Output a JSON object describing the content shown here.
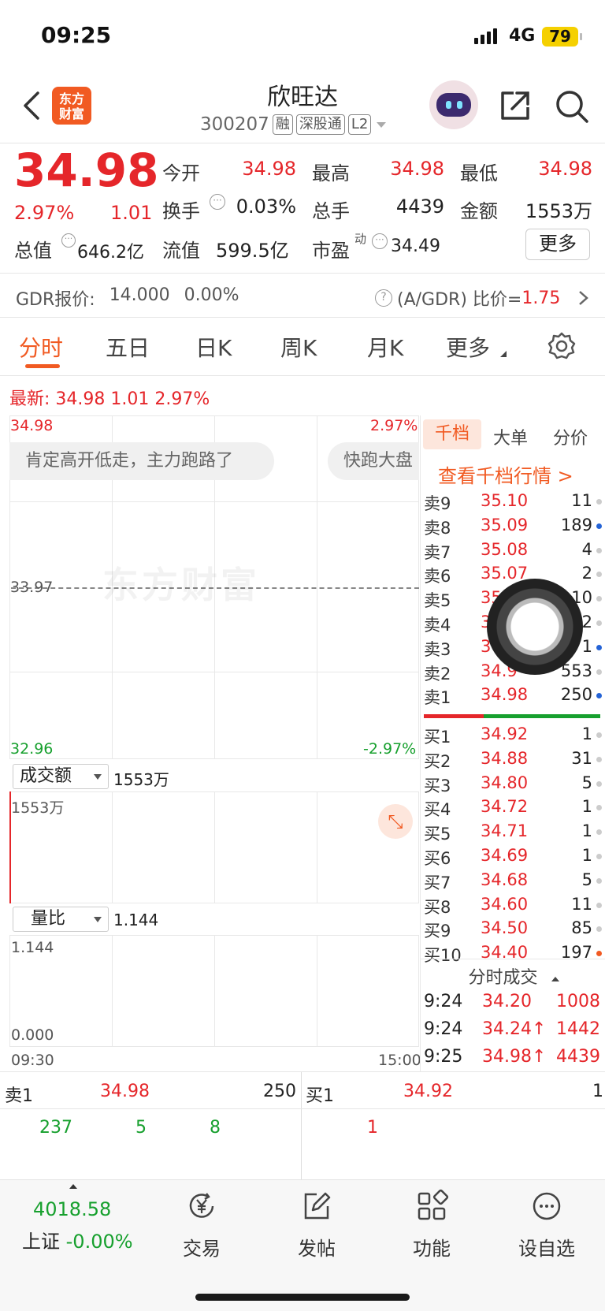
{
  "status": {
    "time": "09:25",
    "network": "4G",
    "battery": "79"
  },
  "header": {
    "logo": "东方财富",
    "stock_name": "欣旺达",
    "stock_code": "300207",
    "tags": [
      "融",
      "深股通",
      "L2"
    ]
  },
  "quote": {
    "price": "34.98",
    "change_pct": "2.97%",
    "change": "1.01",
    "fields": {
      "open_label": "今开",
      "open": "34.98",
      "high_label": "最高",
      "high": "34.98",
      "low_label": "最低",
      "low": "34.98",
      "turnover_label": "换手",
      "turnover": "0.03%",
      "volume_label": "总手",
      "volume": "4439",
      "amount_label": "金额",
      "amount": "1553万",
      "mktcap_label": "总值",
      "mktcap": "646.2亿",
      "float_label": "流值",
      "float": "599.5亿",
      "pe_label": "市盈",
      "pe_sup": "动",
      "pe": "34.49"
    },
    "more_label": "更多"
  },
  "gdr": {
    "label": "GDR报价:",
    "price": "14.000",
    "pct": "0.00%",
    "ratio_label": "(A/GDR) 比价=",
    "ratio": "1.75"
  },
  "tabs": [
    "分时",
    "五日",
    "日K",
    "周K",
    "月K",
    "更多"
  ],
  "chart": {
    "latest_label": "最新:",
    "latest_price": "34.98",
    "latest_change": "1.01",
    "latest_pct": "2.97%",
    "top_price": "34.98",
    "top_pct": "2.97%",
    "mid_price": "33.97",
    "bottom_price": "32.96",
    "bottom_pct": "-2.97%",
    "watermark": "东方财富",
    "comment1": "肯定高开低走，主力跑路了",
    "comment2": "快跑大盘",
    "amount_select": "成交额",
    "amount_value": "1553万",
    "amount_axis": "1553万",
    "ratio_select": "量比",
    "ratio_value": "1.144",
    "ratio_axis_top": "1.144",
    "ratio_axis_bottom": "0.000",
    "time_start": "09:30",
    "time_end": "15:00"
  },
  "orderbook": {
    "tabs": [
      "千档",
      "大单",
      "分价"
    ],
    "link": "查看千档行情 >",
    "asks": [
      {
        "label": "卖9",
        "price": "35.10",
        "vol": "11",
        "dot": "grey"
      },
      {
        "label": "卖8",
        "price": "35.09",
        "vol": "189",
        "dot": "blue"
      },
      {
        "label": "卖7",
        "price": "35.08",
        "vol": "4",
        "dot": "grey"
      },
      {
        "label": "卖6",
        "price": "35.07",
        "vol": "2",
        "dot": "grey"
      },
      {
        "label": "卖5",
        "price": "35.",
        "vol": "10",
        "dot": "grey"
      },
      {
        "label": "卖4",
        "price": "3",
        "vol": "2",
        "dot": "grey"
      },
      {
        "label": "卖3",
        "price": "3",
        "vol": "1",
        "dot": "blue"
      },
      {
        "label": "卖2",
        "price": "34.9",
        "vol": "553",
        "dot": "grey"
      },
      {
        "label": "卖1",
        "price": "34.98",
        "vol": "250",
        "dot": "blue"
      }
    ],
    "bids": [
      {
        "label": "买1",
        "price": "34.92",
        "vol": "1",
        "dot": "grey"
      },
      {
        "label": "买2",
        "price": "34.88",
        "vol": "31",
        "dot": "grey"
      },
      {
        "label": "买3",
        "price": "34.80",
        "vol": "5",
        "dot": "grey"
      },
      {
        "label": "买4",
        "price": "34.72",
        "vol": "1",
        "dot": "grey"
      },
      {
        "label": "买5",
        "price": "34.71",
        "vol": "1",
        "dot": "grey"
      },
      {
        "label": "买6",
        "price": "34.69",
        "vol": "1",
        "dot": "grey"
      },
      {
        "label": "买7",
        "price": "34.68",
        "vol": "5",
        "dot": "grey"
      },
      {
        "label": "买8",
        "price": "34.60",
        "vol": "11",
        "dot": "grey"
      },
      {
        "label": "买9",
        "price": "34.50",
        "vol": "85",
        "dot": "grey"
      },
      {
        "label": "买10",
        "price": "34.40",
        "vol": "197",
        "dot": "orange"
      }
    ],
    "buy_ratio": 0.34,
    "trades_title": "分时成交",
    "trades": [
      {
        "time": "9:24",
        "price": "34.20",
        "vol": "1008",
        "arrow": ""
      },
      {
        "time": "9:24",
        "price": "34.24↑",
        "vol": "1442",
        "arrow": ""
      },
      {
        "time": "9:25",
        "price": "34.98↑",
        "vol": "4439",
        "arrow": ""
      }
    ]
  },
  "bottom_quotes": {
    "ask_label": "卖1",
    "ask_price": "34.98",
    "ask_vol": "250",
    "bid_label": "买1",
    "bid_price": "34.92",
    "bid_vol": "1",
    "ask_queue": [
      "237",
      "5",
      "8"
    ],
    "bid_queue": [
      "1"
    ]
  },
  "nav": {
    "index_value": "4018.58",
    "index_name": "上证",
    "index_pct": "-0.00%",
    "items": [
      "交易",
      "发帖",
      "功能",
      "设自选"
    ]
  },
  "colors": {
    "accent": "#f15a22",
    "up": "#e5262a",
    "down": "#17a02e"
  }
}
